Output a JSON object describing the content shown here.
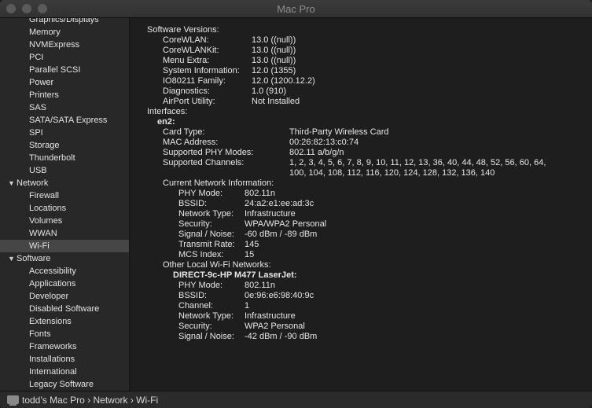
{
  "window": {
    "title": "Mac Pro"
  },
  "sidebar": {
    "items": [
      {
        "label": "Graphics/Displays",
        "kind": "child"
      },
      {
        "label": "Memory",
        "kind": "child"
      },
      {
        "label": "NVMExpress",
        "kind": "child"
      },
      {
        "label": "PCI",
        "kind": "child"
      },
      {
        "label": "Parallel SCSI",
        "kind": "child"
      },
      {
        "label": "Power",
        "kind": "child"
      },
      {
        "label": "Printers",
        "kind": "child"
      },
      {
        "label": "SAS",
        "kind": "child"
      },
      {
        "label": "SATA/SATA Express",
        "kind": "child"
      },
      {
        "label": "SPI",
        "kind": "child"
      },
      {
        "label": "Storage",
        "kind": "child"
      },
      {
        "label": "Thunderbolt",
        "kind": "child"
      },
      {
        "label": "USB",
        "kind": "child"
      },
      {
        "label": "Network",
        "kind": "section"
      },
      {
        "label": "Firewall",
        "kind": "child"
      },
      {
        "label": "Locations",
        "kind": "child"
      },
      {
        "label": "Volumes",
        "kind": "child"
      },
      {
        "label": "WWAN",
        "kind": "child"
      },
      {
        "label": "Wi-Fi",
        "kind": "child",
        "selected": true
      },
      {
        "label": "Software",
        "kind": "section"
      },
      {
        "label": "Accessibility",
        "kind": "child"
      },
      {
        "label": "Applications",
        "kind": "child"
      },
      {
        "label": "Developer",
        "kind": "child"
      },
      {
        "label": "Disabled Software",
        "kind": "child"
      },
      {
        "label": "Extensions",
        "kind": "child"
      },
      {
        "label": "Fonts",
        "kind": "child"
      },
      {
        "label": "Frameworks",
        "kind": "child"
      },
      {
        "label": "Installations",
        "kind": "child"
      },
      {
        "label": "International",
        "kind": "child"
      },
      {
        "label": "Legacy Software",
        "kind": "child"
      }
    ]
  },
  "detail": {
    "rows": [
      {
        "key": "Software Versions:",
        "value": "",
        "indent": 0,
        "bold": false
      },
      {
        "key": "CoreWLAN:",
        "value": "13.0 ((null))",
        "indent": 1,
        "bold": false
      },
      {
        "key": "CoreWLANKit:",
        "value": "13.0 ((null))",
        "indent": 1,
        "bold": false
      },
      {
        "key": "Menu Extra:",
        "value": "13.0 ((null))",
        "indent": 1,
        "bold": false
      },
      {
        "key": "System Information:",
        "value": "12.0 (1355)",
        "indent": 1,
        "bold": false
      },
      {
        "key": "IO80211 Family:",
        "value": "12.0 (1200.12.2)",
        "indent": 1,
        "bold": false
      },
      {
        "key": "Diagnostics:",
        "value": "1.0 (910)",
        "indent": 1,
        "bold": false
      },
      {
        "key": "AirPort Utility:",
        "value": "Not Installed",
        "indent": 1,
        "bold": false
      },
      {
        "key": "Interfaces:",
        "value": "",
        "indent": 0,
        "bold": false
      },
      {
        "key": "en2:",
        "value": "",
        "indent": 2,
        "bold": true
      },
      {
        "key": "Card Type:",
        "value": "Third-Party Wireless Card",
        "indent": 3,
        "bold": false
      },
      {
        "key": "MAC Address:",
        "value": "00:26:82:13:c0:74",
        "indent": 3,
        "bold": false
      },
      {
        "key": "Supported PHY Modes:",
        "value": "802.11 a/b/g/n",
        "indent": 3,
        "bold": false
      },
      {
        "key": "Supported Channels:",
        "value": "1, 2, 3, 4, 5, 6, 7, 8, 9, 10, 11, 12, 13, 36, 40, 44, 48, 52, 56, 60, 64,",
        "indent": 3,
        "bold": false
      },
      {
        "key": "",
        "value": "100, 104, 108, 112, 116, 120, 124, 128, 132, 136, 140",
        "indent": 3,
        "bold": false
      },
      {
        "key": "Current Network Information:",
        "value": "",
        "indent": 3,
        "bold": false
      },
      {
        "key": "PHY Mode:",
        "value": "802.11n",
        "indent": 4,
        "bold": false
      },
      {
        "key": "BSSID:",
        "value": "24:a2:e1:ee:ad:3c",
        "indent": 4,
        "bold": false
      },
      {
        "key": "Network Type:",
        "value": "Infrastructure",
        "indent": 4,
        "bold": false
      },
      {
        "key": "Security:",
        "value": "WPA/WPA2 Personal",
        "indent": 4,
        "bold": false
      },
      {
        "key": "Signal / Noise:",
        "value": "-60 dBm / -89 dBm",
        "indent": 4,
        "bold": false
      },
      {
        "key": "Transmit Rate:",
        "value": "145",
        "indent": 4,
        "bold": false
      },
      {
        "key": "MCS Index:",
        "value": "15",
        "indent": 4,
        "bold": false
      },
      {
        "key": "Other Local Wi-Fi Networks:",
        "value": "",
        "indent": 3,
        "bold": false
      },
      {
        "key": "DIRECT-9c-HP M477 LaserJet:",
        "value": "",
        "indent": 5,
        "bold": true
      },
      {
        "key": "PHY Mode:",
        "value": "802.11n",
        "indent": 4,
        "bold": false
      },
      {
        "key": "BSSID:",
        "value": "0e:96:e6:98:40:9c",
        "indent": 4,
        "bold": false
      },
      {
        "key": "Channel:",
        "value": "1",
        "indent": 4,
        "bold": false
      },
      {
        "key": "Network Type:",
        "value": "Infrastructure",
        "indent": 4,
        "bold": false
      },
      {
        "key": "Security:",
        "value": "WPA2 Personal",
        "indent": 4,
        "bold": false
      },
      {
        "key": "Signal / Noise:",
        "value": "-42 dBm / -90 dBm",
        "indent": 4,
        "bold": false
      }
    ]
  },
  "statusbar": {
    "icon": "computer-icon",
    "path": "todd’s Mac Pro › Network › Wi-Fi"
  },
  "colors": {
    "window_bg": "#1e1e1e",
    "sidebar_bg": "#282828",
    "selection": "#464646",
    "text": "#e6e6e6"
  }
}
